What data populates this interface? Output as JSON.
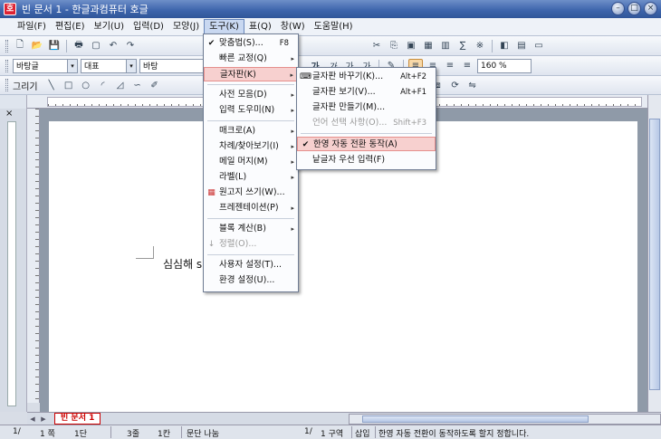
{
  "window": {
    "title": "빈 문서 1 - 한글과컴퓨터 호글",
    "app_icon": "호"
  },
  "menubar": [
    "파일(F)",
    "편집(E)",
    "보기(U)",
    "입력(D)",
    "모양(J)",
    "도구(K)",
    "표(Q)",
    "창(W)",
    "도움말(H)"
  ],
  "toolbar2": {
    "style": "바탕글",
    "style_arrow": "▾",
    "shape": "대표",
    "shape_arrow": "▾",
    "font": "바탕",
    "zoom": "160 %"
  },
  "toolbar3": {
    "draw_label": "그리기"
  },
  "tools_menu": [
    {
      "label": "맞춤법(S)...",
      "shortcut": "F8",
      "icon": "✔"
    },
    {
      "label": "빠른 교정(Q)",
      "submenu": "▸"
    },
    {
      "label": "글자판(K)",
      "submenu": "▸",
      "highlighted": true
    },
    {
      "label": "사전 모음(D)",
      "submenu": "▸"
    },
    {
      "label": "입력 도우미(N)",
      "submenu": "▸"
    },
    {
      "label": "매크로(A)",
      "submenu": "▸"
    },
    {
      "label": "차례/찾아보기(I)",
      "submenu": "▸"
    },
    {
      "label": "메일 머지(M)",
      "submenu": "▸"
    },
    {
      "label": "라벨(L)",
      "submenu": "▸"
    },
    {
      "label": "원고지 쓰기(W)...",
      "icon": "▦"
    },
    {
      "label": "프레젠테이션(P)",
      "submenu": "▸"
    },
    {
      "label": "블록 계산(B)",
      "submenu": "▸"
    },
    {
      "label": "정렬(O)...",
      "disabled": true,
      "icon": "↓"
    },
    {
      "label": "사용자 설정(T)..."
    },
    {
      "label": "환경 설정(U)..."
    }
  ],
  "keyboard_submenu": [
    {
      "label": "글자판 바꾸기(K)...",
      "shortcut": "Alt+F2",
      "icon": "⌨"
    },
    {
      "label": "글자판 보기(V)...",
      "shortcut": "Alt+F1"
    },
    {
      "label": "글자판 만들기(M)..."
    },
    {
      "label": "언어 선택 사항(O)...",
      "shortcut": "Shift+F3",
      "disabled": true
    },
    {
      "label": "한영 자동 전환 동작(A)",
      "checked": true,
      "check": "✔",
      "highlighted": true
    },
    {
      "label": "낱글자 우선 입력(F)"
    }
  ],
  "document": {
    "text": "심심해  s"
  },
  "tabs": {
    "doc_tab": "빈 문서 1"
  },
  "statusbar": {
    "page": "1/",
    "page_num": "1 쪽",
    "section": "1단",
    "line": "3줄",
    "column": "1칸",
    "para": "문단 나눔",
    "section2": "1/",
    "zone": "1 구역",
    "mode": "삽입",
    "message": "한영 자동 전환이 동작하도록 할지 정합니다."
  },
  "colors": {
    "title_bar": "#3f66ad",
    "highlight": "#f7d0cf",
    "tab_accent": "#cc0000"
  }
}
